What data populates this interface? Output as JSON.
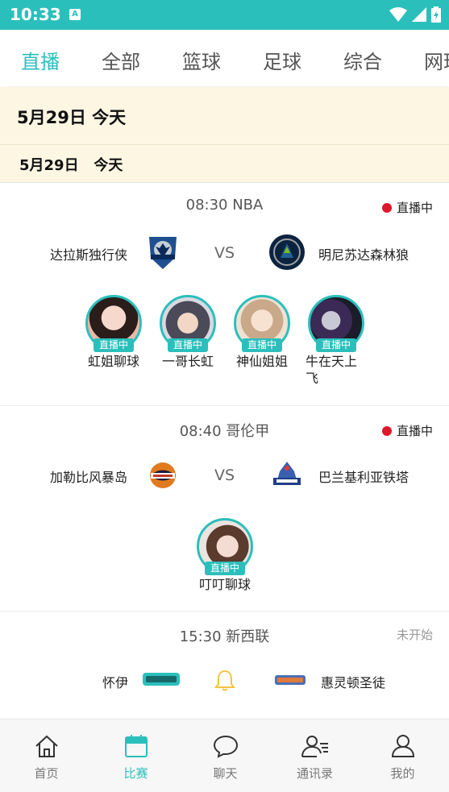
{
  "status_bar": {
    "time": "10:33",
    "notification": "A"
  },
  "tabs": [
    {
      "label": "直播",
      "active": true
    },
    {
      "label": "全部",
      "active": false
    },
    {
      "label": "篮球",
      "active": false
    },
    {
      "label": "足球",
      "active": false
    },
    {
      "label": "综合",
      "active": false
    },
    {
      "label": "网球",
      "active": false
    }
  ],
  "date_header_large": "5月29日 今天",
  "date_header_small": "5月29日   今天",
  "matches": [
    {
      "time_league": "08:30  NBA",
      "status": "直播中",
      "home": "达拉斯独行侠",
      "away": "明尼苏达森林狼",
      "vs": "VS",
      "hosts": [
        {
          "name": "虹姐聊球",
          "badge": "直播中"
        },
        {
          "name": "一哥长虹",
          "badge": "直播中"
        },
        {
          "name": "神仙姐姐",
          "badge": "直播中"
        },
        {
          "name": "牛在天上飞",
          "badge": "直播中"
        }
      ]
    },
    {
      "time_league": "08:40  哥伦甲",
      "status": "直播中",
      "home": "加勒比风暴岛",
      "away": "巴兰基利亚铁塔",
      "vs": "VS",
      "hosts": [
        {
          "name": "叮叮聊球",
          "badge": "直播中"
        }
      ]
    },
    {
      "time_league": "15:30  新西联",
      "status": "未开始",
      "home": "怀伊",
      "away": "惠灵顿圣徒"
    }
  ],
  "bottom_nav": [
    {
      "label": "首页",
      "icon": "home-icon",
      "active": false
    },
    {
      "label": "比赛",
      "icon": "calendar-icon",
      "active": true
    },
    {
      "label": "聊天",
      "icon": "chat-bubble-icon",
      "active": false
    },
    {
      "label": "通讯录",
      "icon": "contacts-icon",
      "active": false
    },
    {
      "label": "我的",
      "icon": "profile-icon",
      "active": false
    }
  ],
  "colors": {
    "accent": "#2bbfbc",
    "live_dot": "#e0162b",
    "date_bg": "#fdf6e3"
  }
}
